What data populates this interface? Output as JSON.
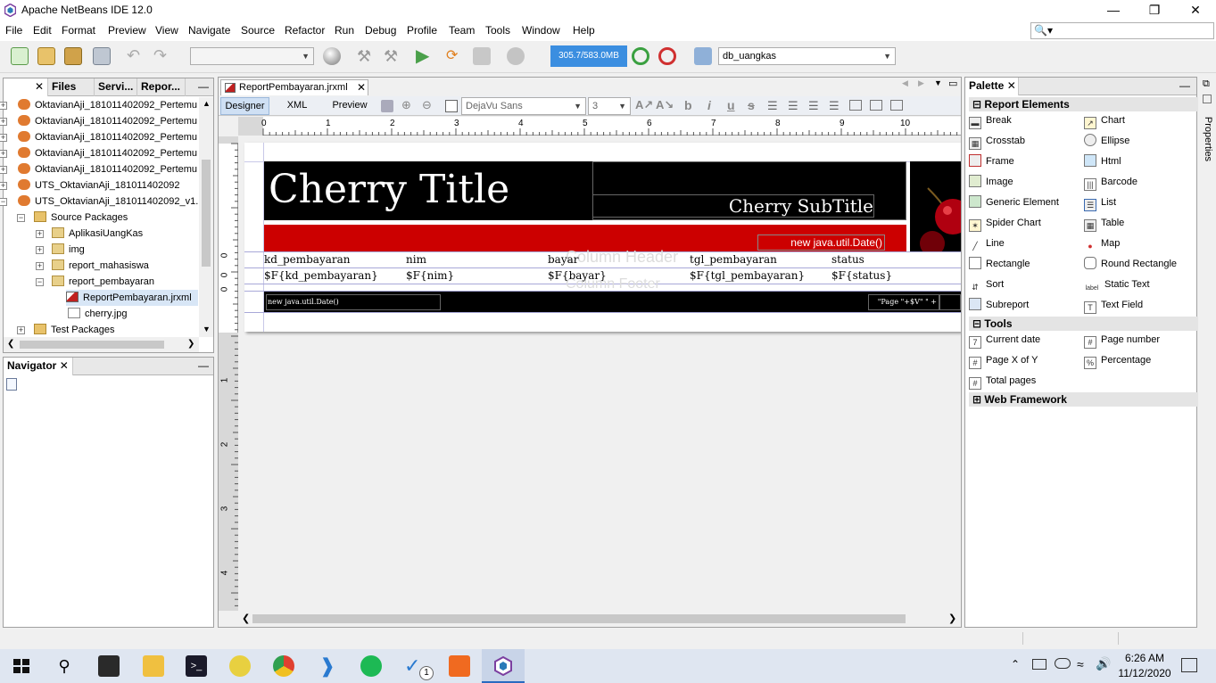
{
  "window": {
    "title": "Apache NetBeans IDE 12.0"
  },
  "menu": [
    "File",
    "Edit",
    "Format",
    "Preview",
    "View",
    "Navigate",
    "Source",
    "Refactor",
    "Run",
    "Debug",
    "Profile",
    "Team",
    "Tools",
    "Window",
    "Help"
  ],
  "toolbar": {
    "memory": "305.7/583.0MB",
    "db_combo": "db_uangkas",
    "config_combo": ""
  },
  "projects_panel": {
    "tabs": [
      "Files",
      "Servi...",
      "Repor..."
    ],
    "tree": [
      "OktavianAji_181011402092_Pertemu",
      "OktavianAji_181011402092_Pertemu",
      "OktavianAji_181011402092_Pertemu",
      "OktavianAji_181011402092_Pertemu",
      "OktavianAji_181011402092_Pertemu",
      "UTS_OktavianAji_181011402092",
      "UTS_OktavianAji_181011402092_v1.",
      "Source Packages",
      "AplikasiUangKas",
      "img",
      "report_mahasiswa",
      "report_pembayaran",
      "ReportPembayaran.jrxml",
      "cherry.jpg",
      "Test Packages"
    ]
  },
  "navigator": {
    "title": "Navigator"
  },
  "editor": {
    "file_tab": "ReportPembayaran.jrxml",
    "view_tabs": [
      "Designer",
      "XML",
      "Preview"
    ],
    "font_combo": "DejaVu Sans",
    "size_combo": "3",
    "ruler": [
      "0",
      "1",
      "2",
      "3",
      "4",
      "5",
      "6",
      "7",
      "8",
      "9",
      "10"
    ],
    "vruler": [
      "0",
      "0",
      "0",
      "1",
      "2",
      "3",
      "4"
    ]
  },
  "report": {
    "title": "Cherry Title",
    "subtitle": "Cherry SubTitle",
    "date_expr": "new java.util.Date()",
    "column_header_bg": "Column Header",
    "column_footer_bg": "Column Footer",
    "columns": [
      "kd_pembayaran",
      "nim",
      "bayar",
      "tgl_pembayaran",
      "status"
    ],
    "fields": [
      "$F{kd_pembayaran}",
      "$F{nim}",
      "$F{bayar}",
      "$F{tgl_pembayaran}",
      "$F{status}"
    ],
    "footer_date": "new java.util.Date()",
    "footer_page": "\"Page \"+$V\" \" + ",
    "colors": {
      "title_band": "#000000",
      "red_band": "#cc0000"
    }
  },
  "palette": {
    "title": "Palette",
    "sections": [
      "Report Elements",
      "Tools",
      "Web Framework"
    ],
    "report_elements": [
      [
        "Break",
        "Chart"
      ],
      [
        "Crosstab",
        "Ellipse"
      ],
      [
        "Frame",
        "Html"
      ],
      [
        "Image",
        "Barcode"
      ],
      [
        "Generic Element",
        "List"
      ],
      [
        "Spider Chart",
        "Table"
      ],
      [
        "Line",
        "Map"
      ],
      [
        "Rectangle",
        "Round Rectangle"
      ],
      [
        "Sort",
        "Static Text"
      ],
      [
        "Subreport",
        "Text Field"
      ]
    ],
    "tools": [
      [
        "Current date",
        "Page number"
      ],
      [
        "Page X of Y",
        "Percentage"
      ],
      [
        "Total pages",
        ""
      ]
    ],
    "icon_labels": {
      "static_text": "label"
    }
  },
  "side_strip": {
    "properties": "Properties"
  },
  "taskbar": {
    "time": "6:26 AM",
    "date": "11/12/2020",
    "badge": "1"
  }
}
